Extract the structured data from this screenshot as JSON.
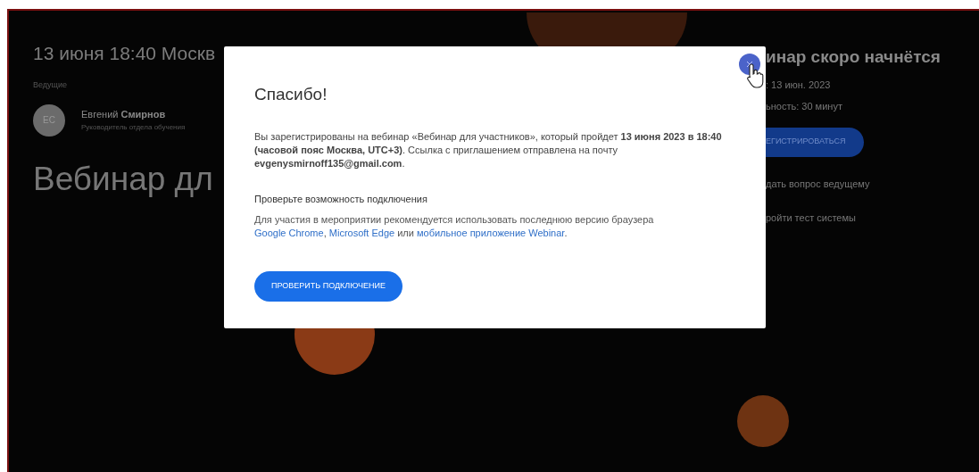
{
  "page": {
    "date_line": "13 июня 18:40 Москв",
    "hosts_label": "Ведущие",
    "host": {
      "initials": "ЕС",
      "name": "Евгений **Смирнов**",
      "role": "Руководитель отдела обучения"
    },
    "title": "Вебинар дл",
    "side": {
      "heading": "инар скоро начнётся",
      "date": ": 13 июн. 2023",
      "duration": "ьность: 30 минут",
      "register_button": "ЕГИСТРИРОВАТЬСЯ",
      "links": [
        "дать вопрос ведущему",
        "ройти тест системы"
      ]
    }
  },
  "dialog": {
    "title": "Спасибо!",
    "message": "Вы зарегистрированы на вебинар «Вебинар для участников», который пройдет **13 июня 2023 в 18:40 (часовой пояс Москва, UTC+3)**. Ссылка с приглашением отправлена на почту **evgenysmirnoff135@gmail.com**.",
    "check_heading": "Проверьте возможность подключения",
    "check_text": [
      {
        "kind": "text",
        "text": "Для участия в мероприятии рекомендуется использовать последнюю версию браузера "
      },
      {
        "kind": "link",
        "text": "Google Chrome"
      },
      {
        "kind": "text",
        "text": ", "
      },
      {
        "kind": "link",
        "text": "Microsoft Edge"
      },
      {
        "kind": "text",
        "text": " или "
      },
      {
        "kind": "link",
        "text": "мобильное приложение Webinar"
      },
      {
        "kind": "text",
        "text": "."
      }
    ],
    "check_button": "ПРОВЕРИТЬ ПОДКЛЮЧЕНИЕ",
    "close_hovered": true
  }
}
